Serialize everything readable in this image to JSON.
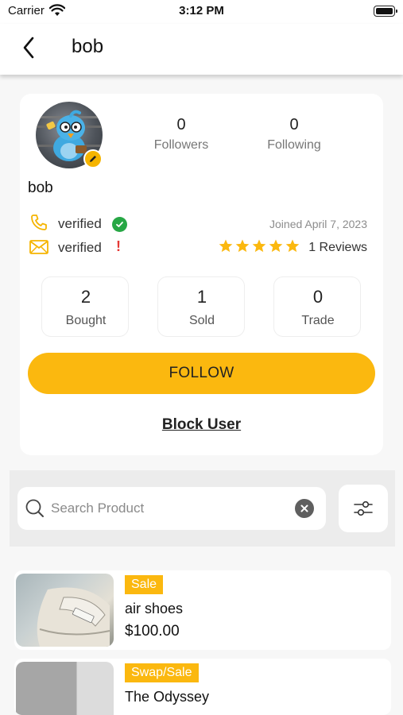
{
  "status_bar": {
    "carrier": "Carrier",
    "time": "3:12 PM"
  },
  "header": {
    "title": "bob"
  },
  "profile": {
    "username": "bob",
    "followers": {
      "count": "0",
      "label": "Followers"
    },
    "following": {
      "count": "0",
      "label": "Following"
    },
    "phone_status": "verified",
    "email_status": "verified",
    "joined": "Joined April 7, 2023",
    "rating": 5,
    "reviews": "1 Reviews",
    "counts": [
      {
        "value": "2",
        "label": "Bought"
      },
      {
        "value": "1",
        "label": "Sold"
      },
      {
        "value": "0",
        "label": "Trade"
      }
    ],
    "follow_label": "FOLLOW",
    "block_label": "Block User"
  },
  "search": {
    "placeholder": "Search Product"
  },
  "products": [
    {
      "tag": "Sale",
      "name": "air shoes",
      "price": "$100.00"
    },
    {
      "tag": "Swap/Sale",
      "name": "The Odyssey",
      "price": ""
    }
  ],
  "colors": {
    "accent": "#fbb80f",
    "verified_green": "#27a745",
    "warning_red": "#e53935"
  }
}
